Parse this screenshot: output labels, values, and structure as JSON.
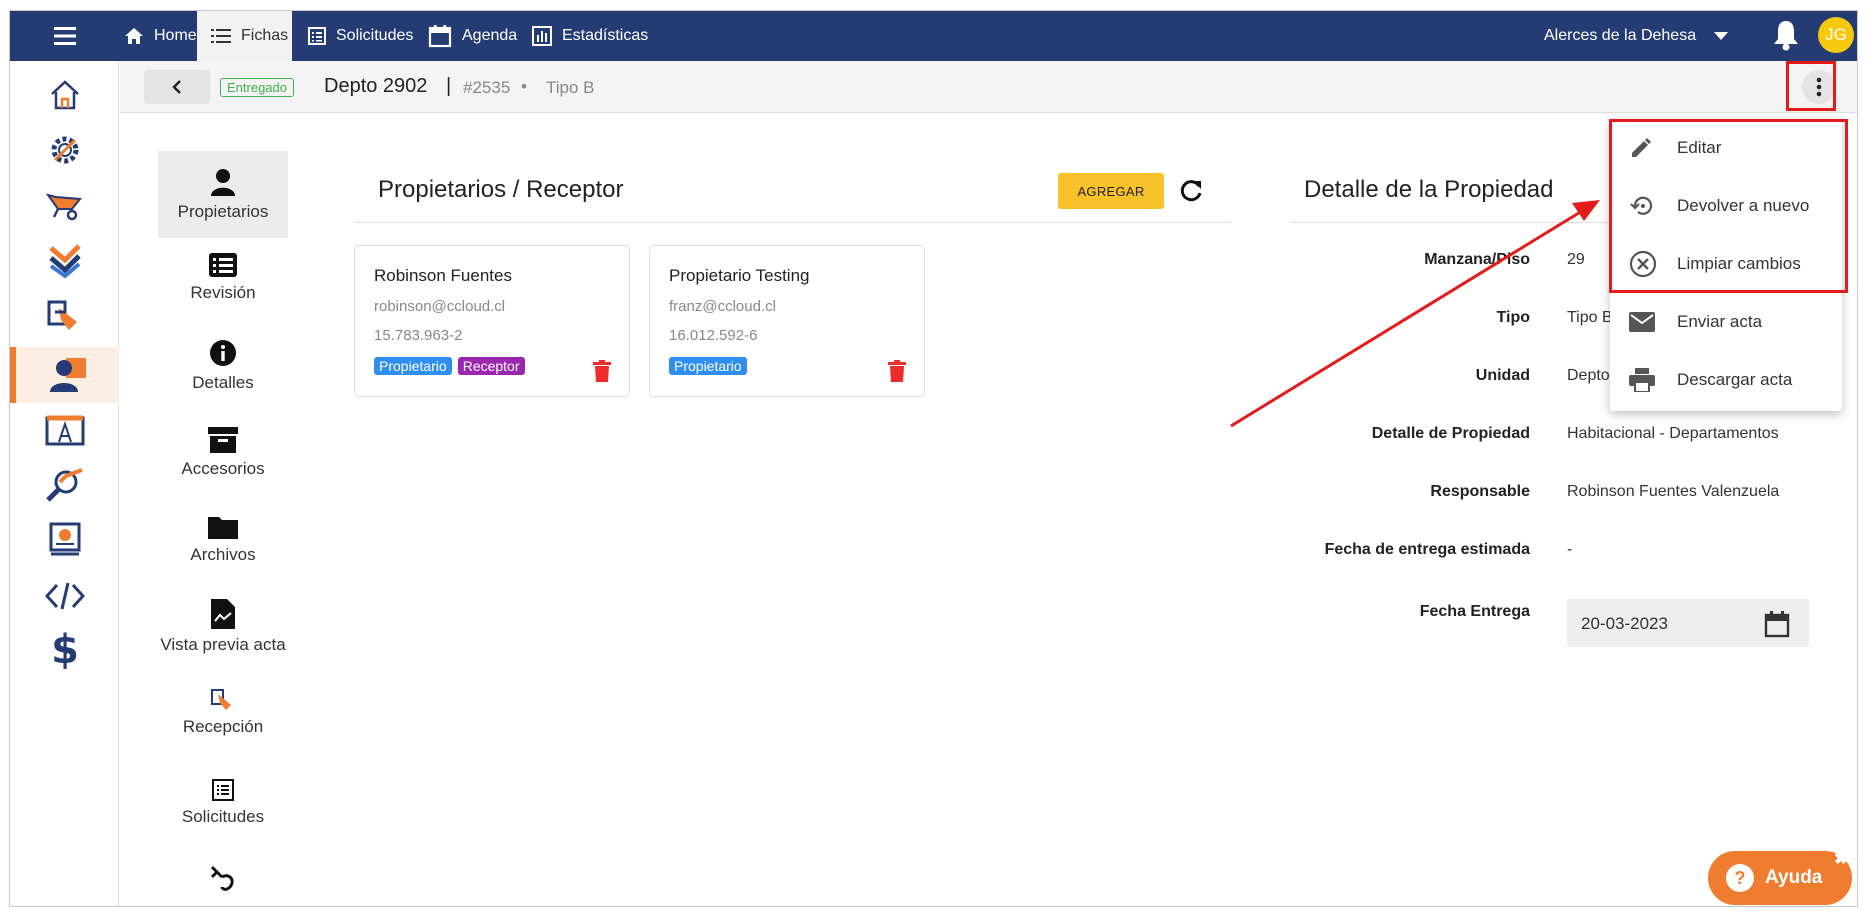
{
  "nav": {
    "tabs": [
      {
        "label": "Home",
        "icon": "home-icon"
      },
      {
        "label": "Fichas",
        "icon": "list-icon"
      },
      {
        "label": "Solicitudes",
        "icon": "list-box-icon"
      },
      {
        "label": "Agenda",
        "icon": "calendar-icon"
      },
      {
        "label": "Estadísticas",
        "icon": "chart-icon"
      }
    ],
    "active_tab": "Fichas",
    "project": "Alerces de la Dehesa",
    "avatar_initials": "JG"
  },
  "sidebar_icons": [
    "home-outline-icon",
    "gear-tools-icon",
    "wheelbarrow-icon",
    "checkmarks-icon",
    "delivery-icon",
    "user-delivery-icon",
    "blueprint-icon",
    "magnifier-icon",
    "invoice-icon",
    "code-icon",
    "dollar-icon"
  ],
  "header": {
    "status": "Entregado",
    "title": "Depto 2902",
    "separator": "|",
    "id": "#2535",
    "dot": "•",
    "type": "Tipo B"
  },
  "left_nav": [
    {
      "label": "Propietarios",
      "icon": "person-icon"
    },
    {
      "label": "Revisión",
      "icon": "checklist-icon"
    },
    {
      "label": "Detalles",
      "icon": "info-icon"
    },
    {
      "label": "Accesorios",
      "icon": "archive-box-icon"
    },
    {
      "label": "Archivos",
      "icon": "folder-icon"
    },
    {
      "label": "Vista previa acta",
      "icon": "document-icon"
    },
    {
      "label": "Recepción",
      "icon": "reception-icon"
    },
    {
      "label": "Solicitudes",
      "icon": "list-box-icon"
    },
    {
      "label": "",
      "icon": "undo-icon"
    }
  ],
  "owners": {
    "title": "Propietarios / Receptor",
    "add_label": "AGREGAR",
    "cards": [
      {
        "name": "Robinson Fuentes",
        "email": "robinson@ccloud.cl",
        "rut": "15.783.963-2",
        "tags": [
          "Propietario",
          "Receptor"
        ]
      },
      {
        "name": "Propietario Testing",
        "email": "franz@ccloud.cl",
        "rut": "16.012.592-6",
        "tags": [
          "Propietario"
        ]
      }
    ]
  },
  "details": {
    "title": "Detalle de la Propiedad",
    "rows": [
      {
        "label": "Manzana/Piso",
        "value": "29"
      },
      {
        "label": "Tipo",
        "value": "Tipo B"
      },
      {
        "label": "Unidad",
        "value": "Depto 2902"
      },
      {
        "label": "Detalle de Propiedad",
        "value": "Habitacional - Departamentos"
      },
      {
        "label": "Responsable",
        "value": "Robinson Fuentes Valenzuela"
      },
      {
        "label": "Fecha de entrega estimada",
        "value": "-"
      },
      {
        "label": "Fecha Entrega",
        "value": "20-03-2023"
      }
    ]
  },
  "menu": {
    "items": [
      {
        "label": "Editar",
        "icon": "pencil-icon"
      },
      {
        "label": "Devolver a nuevo",
        "icon": "restore-icon"
      },
      {
        "label": "Limpiar cambios",
        "icon": "clear-circle-icon"
      },
      {
        "label": "Enviar acta",
        "icon": "mail-icon"
      },
      {
        "label": "Descargar acta",
        "icon": "print-icon"
      }
    ]
  },
  "help": {
    "label": "Ayuda",
    "icon_glyph": "?",
    "close_glyph": "✖"
  },
  "colors": {
    "navbar": "#253b73",
    "accent": "#f07c30",
    "highlight": "#e31b1b",
    "add_button": "#f9c12a",
    "tag_blue": "#2f8ff0",
    "tag_purple": "#9b27b0",
    "status_green": "#42b04a"
  }
}
